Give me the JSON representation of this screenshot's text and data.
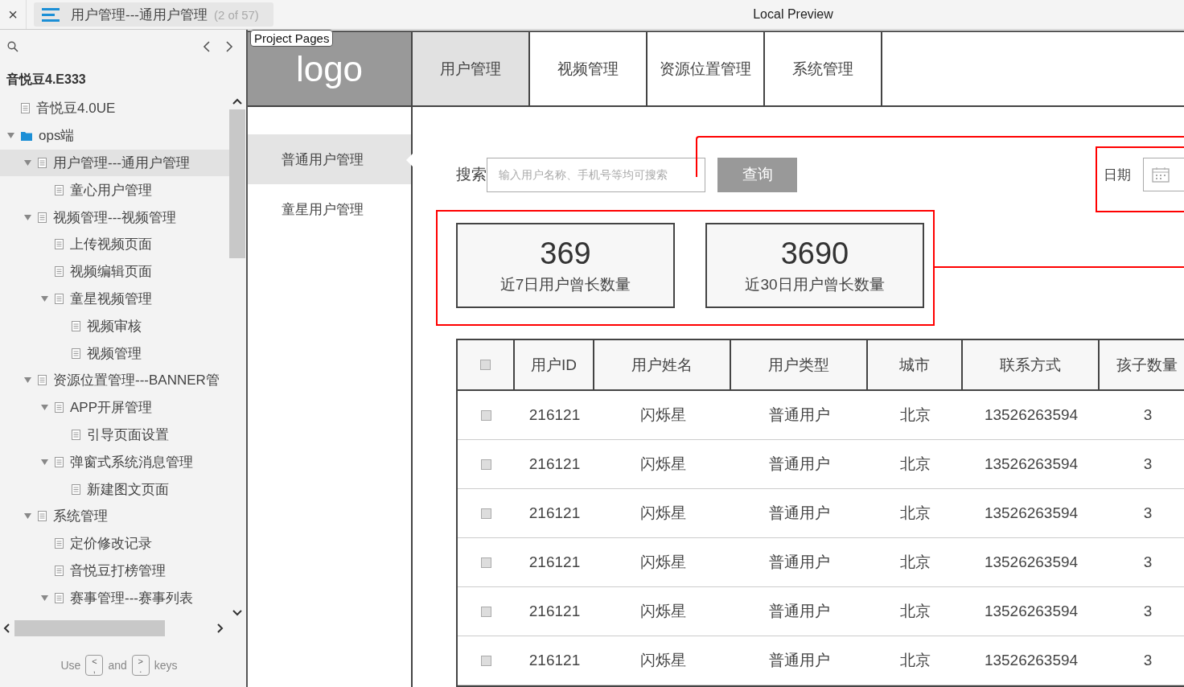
{
  "top_bar": {
    "close": "×",
    "page_title": "用户管理---通用户管理",
    "page_count": "(2 of 57)",
    "preview_title": "Local Preview"
  },
  "tooltip": "Project Pages",
  "sidebar": {
    "project": "音悦豆4.E333",
    "tree": [
      {
        "label": "音悦豆4.0UE",
        "kind": "page",
        "selected": false
      },
      {
        "label": "ops端",
        "kind": "folder",
        "selected": false,
        "expanded": true,
        "children": [
          {
            "label": "用户管理---通用户管理",
            "kind": "page",
            "selected": true,
            "expanded": true,
            "children": [
              {
                "label": "童心用户管理",
                "kind": "page",
                "selected": false
              }
            ]
          },
          {
            "label": "视频管理---视频管理",
            "kind": "page",
            "selected": false,
            "expanded": true,
            "children": [
              {
                "label": "上传视频页面",
                "kind": "page",
                "selected": false
              },
              {
                "label": "视频编辑页面",
                "kind": "page",
                "selected": false
              },
              {
                "label": "童星视频管理",
                "kind": "page",
                "selected": false,
                "expanded": true,
                "children": [
                  {
                    "label": "视频审核",
                    "kind": "page",
                    "selected": false
                  },
                  {
                    "label": "视频管理",
                    "kind": "page",
                    "selected": false
                  }
                ]
              }
            ]
          },
          {
            "label": "资源位置管理---BANNER管",
            "kind": "page",
            "selected": false,
            "expanded": true,
            "children": [
              {
                "label": "APP开屏管理",
                "kind": "page",
                "selected": false,
                "expanded": true,
                "children": [
                  {
                    "label": "引导页面设置",
                    "kind": "page",
                    "selected": false
                  }
                ]
              },
              {
                "label": "弹窗式系统消息管理",
                "kind": "page",
                "selected": false,
                "expanded": true,
                "children": [
                  {
                    "label": "新建图文页面",
                    "kind": "page",
                    "selected": false
                  }
                ]
              }
            ]
          },
          {
            "label": "系统管理",
            "kind": "page",
            "selected": false,
            "expanded": true,
            "children": [
              {
                "label": "定价修改记录",
                "kind": "page",
                "selected": false
              },
              {
                "label": "音悦豆打榜管理",
                "kind": "page",
                "selected": false
              },
              {
                "label": "赛事管理---赛事列表",
                "kind": "page",
                "selected": false,
                "expanded": true
              }
            ]
          }
        ]
      }
    ],
    "help": {
      "use": "Use",
      "and": "and",
      "keys": "keys",
      "prev_key": {
        "top": "<",
        "bottom": ","
      },
      "next_key": {
        "top": ">",
        "bottom": "."
      }
    }
  },
  "prototype": {
    "logo": "logo",
    "tabs": [
      {
        "label": "用户管理",
        "selected": true
      },
      {
        "label": "视频管理",
        "selected": false
      },
      {
        "label": "资源位置管理",
        "selected": false
      },
      {
        "label": "系统管理",
        "selected": false
      }
    ],
    "side_nav": [
      {
        "label": "普通用户管理",
        "selected": true
      },
      {
        "label": "童星用户管理",
        "selected": false
      }
    ],
    "search": {
      "label": "搜索",
      "placeholder": "输入用户名称、手机号等均可搜索",
      "button": "查询"
    },
    "date": {
      "label": "日期"
    },
    "stats": [
      {
        "value": "369",
        "label": "近7日用户曾长数量"
      },
      {
        "value": "3690",
        "label": "近30日用户曾长数量"
      }
    ],
    "table": {
      "header_checked": false,
      "columns": [
        "用户ID",
        "用户姓名",
        "用户类型",
        "城市",
        "联系方式",
        "孩子数量"
      ],
      "rows": [
        {
          "checked": false,
          "cells": [
            "216121",
            "闪烁星",
            "普通用户",
            "北京",
            "13526263594",
            "3"
          ]
        },
        {
          "checked": false,
          "cells": [
            "216121",
            "闪烁星",
            "普通用户",
            "北京",
            "13526263594",
            "3"
          ]
        },
        {
          "checked": false,
          "cells": [
            "216121",
            "闪烁星",
            "普通用户",
            "北京",
            "13526263594",
            "3"
          ]
        },
        {
          "checked": false,
          "cells": [
            "216121",
            "闪烁星",
            "普通用户",
            "北京",
            "13526263594",
            "3"
          ]
        },
        {
          "checked": false,
          "cells": [
            "216121",
            "闪烁星",
            "普通用户",
            "北京",
            "13526263594",
            "3"
          ]
        },
        {
          "checked": false,
          "cells": [
            "216121",
            "闪烁星",
            "普通用户",
            "北京",
            "13526263594",
            "3"
          ]
        }
      ]
    }
  }
}
